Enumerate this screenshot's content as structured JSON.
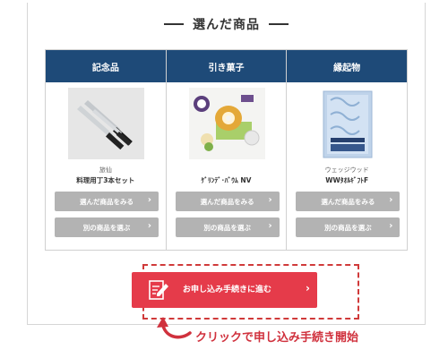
{
  "section_title": "選んだ商品",
  "columns": [
    {
      "header": "記念品",
      "brand": "旅仙",
      "product": "料理用丁3本セット",
      "view_label": "選んだ商品をみる",
      "choose_label": "別の商品を選ぶ",
      "thumb_icon": "kitchen-knife-set-image"
    },
    {
      "header": "引き菓子",
      "brand": "",
      "product": "ｹﾞﾘﾝﾃﾞ･ﾊﾞｳﾑ NV",
      "view_label": "選んだ商品をみる",
      "choose_label": "別の商品を選ぶ",
      "thumb_icon": "baumkuchen-cake-image"
    },
    {
      "header": "縁起物",
      "brand": "ウェッジウッド",
      "product": "WWﾀｵﾙｷﾞﾌﾄF",
      "view_label": "選んだ商品をみる",
      "choose_label": "別の商品を選ぶ",
      "thumb_icon": "towel-gift-box-image"
    }
  ],
  "apply_button": "お申し込み手続きに進む",
  "hint_text": "クリックで申し込み手続き開始",
  "colors": {
    "header_bg": "#1e4a78",
    "gray_button": "#b3b3b3",
    "apply_red": "#e53b4a",
    "hint_red": "#d0313d"
  }
}
